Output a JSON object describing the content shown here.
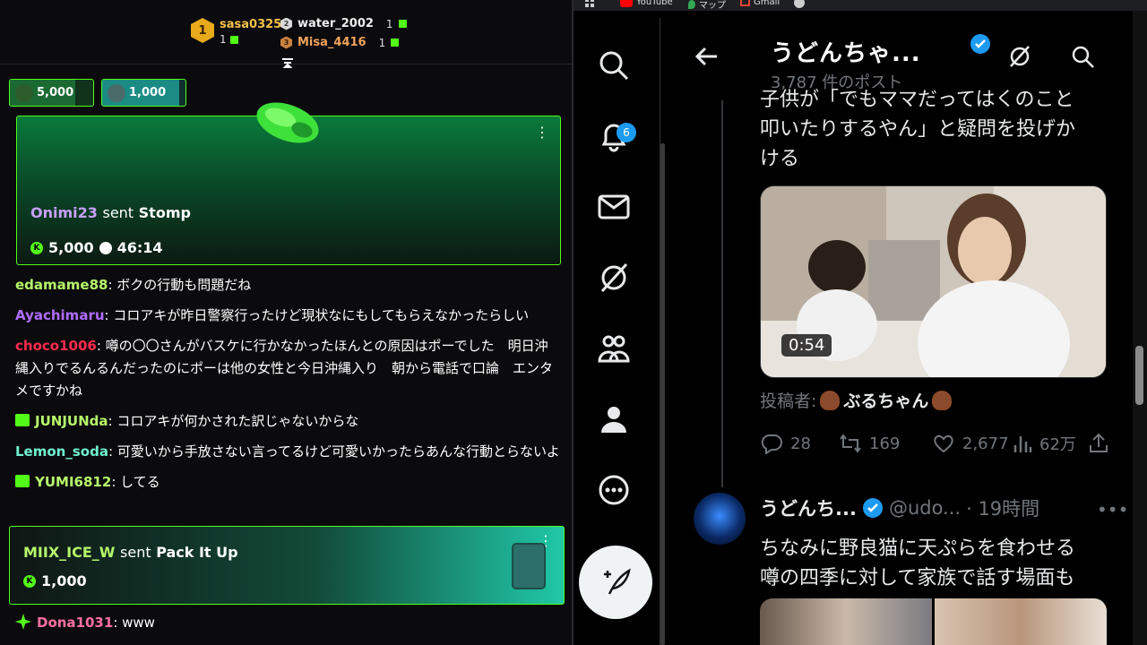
{
  "chat": {
    "leaderboard": {
      "first": {
        "rank": "1",
        "name": "sasa0325",
        "count": "1"
      },
      "second": {
        "rank": "2",
        "name": "water_2002",
        "count": "1"
      },
      "third": {
        "rank": "3",
        "name": "Misa_4416",
        "count": "1"
      }
    },
    "pinned_gifts": [
      {
        "amount": "5,000"
      },
      {
        "amount": "1,000"
      }
    ],
    "stomp_card": {
      "user": "Onimi23",
      "sent": "sent",
      "gift": "Stomp",
      "amount": "5,000",
      "timer": "46:14"
    },
    "messages": [
      {
        "user": "edamame88",
        "text": ": ボクの行動も問題だね",
        "color": "#b6f76a"
      },
      {
        "user": "Ayachimaru",
        "text": ": コロアキが昨日警察行ったけど現状なにもしてもらえなかったらしい",
        "color": "#b16cff"
      },
      {
        "user": "choco1006",
        "text": ": 噂の〇〇さんがバスケに行かなかったほんとの原因はポーでした　明日沖縄入りでるんるんだったのにポーは他の女性と今日沖縄入り　朝から電話で口論　エンタメですかね",
        "color": "#ff2b4f"
      },
      {
        "user": "JUNJUNda",
        "text": ": コロアキが何かされた訳じゃないからな",
        "color": "#b6f76a"
      },
      {
        "user": "Lemon_soda",
        "text": ": 可愛いから手放さない言ってるけど可愛いかったらあんな行動とらないよ",
        "color": "#6ff0d0"
      },
      {
        "user": "YUMI6812",
        "text": ": してる",
        "color": "#b6f76a"
      }
    ],
    "pack_card": {
      "user": "MIIX_ICE_W",
      "sent": "sent",
      "gift": "Pack It Up",
      "amount": "1,000"
    },
    "last_message": {
      "user": "Dona1031",
      "text": ": www",
      "color": "#ff6fa0"
    }
  },
  "browser": {
    "bookmarks": [
      {
        "label": "YouTube"
      },
      {
        "label": "マップ"
      },
      {
        "label": "Gmail"
      }
    ]
  },
  "x": {
    "nav": {
      "notifications_count": "6"
    },
    "header": {
      "title": "うどんちゃ...",
      "post_count": "3,787 件のポスト"
    },
    "tweet1": {
      "text_lines": [
        "子供が「でもママだってはくのこと",
        "叩いたりするやん」と疑問を投げか",
        "ける"
      ],
      "duration": "0:54",
      "author_prefix": "投稿者:",
      "author_name": "ぶるちゃん",
      "replies": "28",
      "reposts": "169",
      "likes": "2,677",
      "views": "62万"
    },
    "tweet2": {
      "name": "うどんち...",
      "handle": "@udo...",
      "time": "· 19時間",
      "text_lines": [
        "ちなみに野良猫に天ぷらを食わせる",
        "噂の四季に対して家族で話す場面も"
      ]
    },
    "colors": {
      "accent": "#1d9bf0",
      "kick_green": "#53fc18"
    }
  }
}
